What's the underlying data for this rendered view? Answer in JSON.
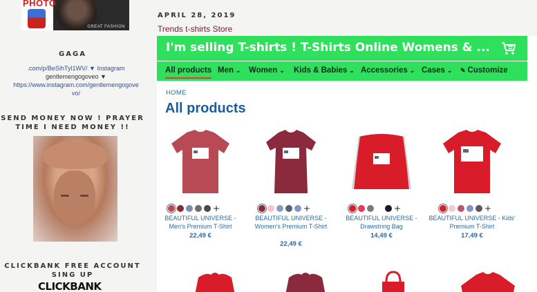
{
  "sidebar": {
    "top_image": {
      "photo_word": "PHOTO",
      "brand": "GREAT FASHION"
    },
    "gaga": {
      "title": "GAGA",
      "line1": ".com/p/BeSihTyl1WV/ ▼ Instagram",
      "line2": "gentlemengogoveo ▼",
      "line3": "https://www.instagram.com/gentlemengogove",
      "line4": "vo/"
    },
    "money": {
      "title_line1": "SEND MONEY NOW ! PRAYER",
      "title_line2": "TIME I NEED MONEY !!"
    },
    "clickbank": {
      "title_line1": "CLICKBANK FREE ACCOUNT",
      "title_line2": "SING UP",
      "logo": "CLICKBANK"
    }
  },
  "post": {
    "date": "APRIL 28, 2019",
    "title": "Trends t-shirts Store"
  },
  "shop": {
    "banner_title": "I'm selling T-shirts ! T-Shirts Online Womens & ...",
    "nav": [
      {
        "label": "All products",
        "active": true
      },
      {
        "label": "Men"
      },
      {
        "label": "Women"
      },
      {
        "label": "Kids & Babies"
      },
      {
        "label": "Accessories"
      },
      {
        "label": "Cases"
      },
      {
        "label": "Customize"
      }
    ],
    "breadcrumb": "HOME",
    "heading": "All products",
    "products": [
      {
        "name": "BEAUTIFUL UNIVERSE - Men's Premium T-Shirt",
        "price": "22,49 €",
        "colors": [
          "#b84a56",
          "#8a2a34",
          "#7b8fb0",
          "#6d6d6d",
          "#4a4a4a"
        ]
      },
      {
        "name": "BEAUTIFUL UNIVERSE - Women's Premium T-Shirt",
        "price": "22,49 €",
        "colors": [
          "#8a2a3c",
          "#f4c4cc",
          "#8e9ac0",
          "#5d6070",
          "#8494c8"
        ]
      },
      {
        "name": "BEAUTIFUL UNIVERSE - Drawstring Bag",
        "price": "14,49 €",
        "colors": [
          "#d81c2a",
          "#e33a5a",
          "#7a7a7a",
          "#ffffff",
          "#1a1a2a"
        ]
      },
      {
        "name": "BEAUTIFUL UNIVERSE - Kids' Premium T-Shirt",
        "price": "17,49 €",
        "colors": [
          "#d81c2a",
          "#f7c9cf",
          "#b05a6a",
          "#8494c8",
          "#5a5a5a"
        ]
      }
    ],
    "colors": {
      "banner_green": "#2ee05c",
      "link_blue": "#2a6aa0"
    }
  }
}
